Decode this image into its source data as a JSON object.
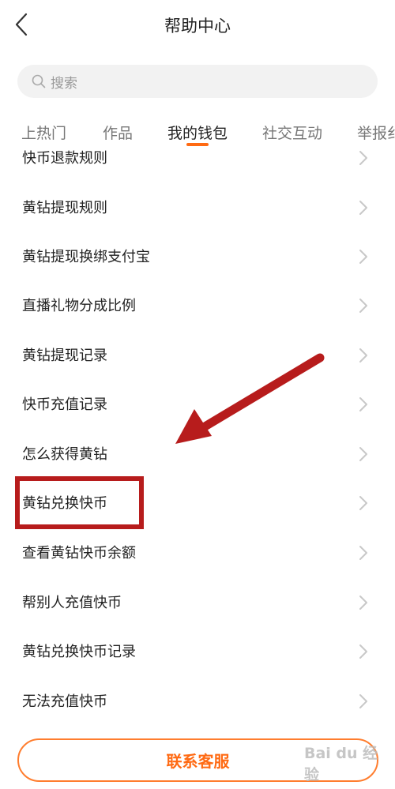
{
  "header": {
    "title": "帮助中心"
  },
  "search": {
    "placeholder": "搜索"
  },
  "tabs": [
    {
      "label": "上热门"
    },
    {
      "label": "作品"
    },
    {
      "label": "我的钱包",
      "active": true
    },
    {
      "label": "社交互动"
    },
    {
      "label": "举报纟"
    }
  ],
  "list": {
    "items": [
      {
        "label": "快币退款规则"
      },
      {
        "label": "黄钻提现规则"
      },
      {
        "label": "黄钻提现换绑支付宝"
      },
      {
        "label": "直播礼物分成比例"
      },
      {
        "label": "黄钻提现记录"
      },
      {
        "label": "快币充值记录"
      },
      {
        "label": "怎么获得黄钻"
      },
      {
        "label": "黄钻兑换快币"
      },
      {
        "label": "查看黄钻快币余额"
      },
      {
        "label": "帮别人充值快币"
      },
      {
        "label": "黄钻兑换快币记录"
      },
      {
        "label": "无法充值快币"
      }
    ]
  },
  "footer": {
    "contact_label": "联系客服"
  },
  "watermark": {
    "text": "Bai du 经验"
  },
  "colors": {
    "accent": "#ff6a13",
    "annotation": "#b71c1c"
  }
}
